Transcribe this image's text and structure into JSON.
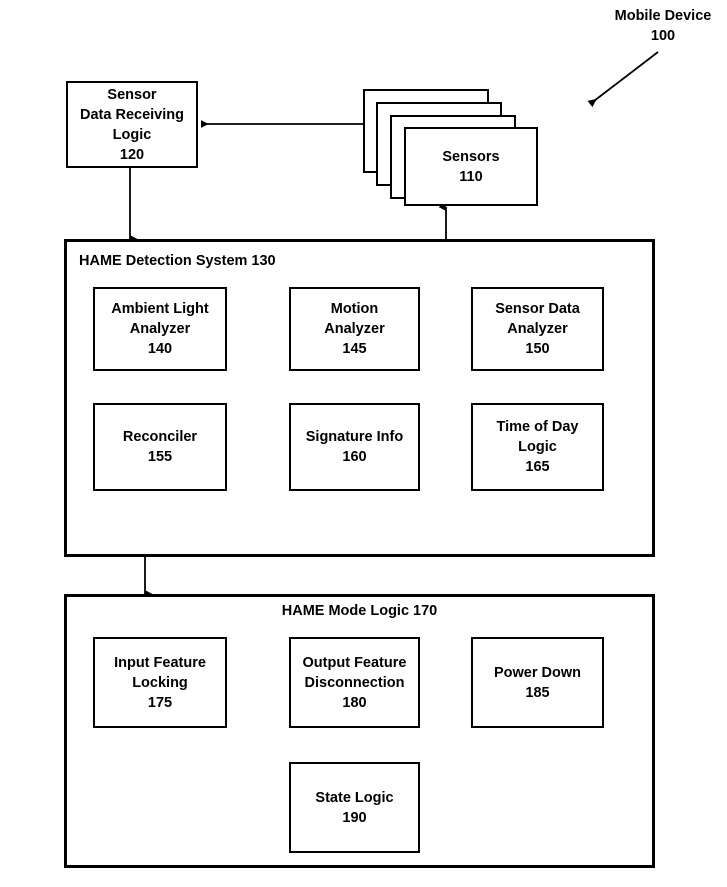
{
  "figure": {
    "type": "patent-block-diagram",
    "background_color": "#ffffff",
    "line_color": "#000000"
  },
  "annotation": {
    "mobile_device_title": "Mobile Device",
    "mobile_device_ref": "100"
  },
  "sensor_receiving": {
    "line1": "Sensor",
    "line2": "Data Receiving",
    "line3": "Logic",
    "ref": "120"
  },
  "sensors": {
    "label": "Sensors",
    "ref": "110",
    "stack_count": 4
  },
  "detection_system": {
    "title": "HAME Detection System 130",
    "blocks": [
      {
        "name": "ambient-light-analyzer",
        "line1": "Ambient Light",
        "line2": "Analyzer",
        "ref": "140"
      },
      {
        "name": "motion-analyzer",
        "line1": "Motion",
        "line2": "Analyzer",
        "ref": "145"
      },
      {
        "name": "sensor-data-analyzer",
        "line1": "Sensor Data",
        "line2": "Analyzer",
        "ref": "150"
      },
      {
        "name": "reconciler",
        "line1": "Reconciler",
        "line2": "",
        "ref": "155"
      },
      {
        "name": "signature-info",
        "line1": "Signature Info",
        "line2": "",
        "ref": "160"
      },
      {
        "name": "time-of-day-logic",
        "line1": "Time of Day",
        "line2": "Logic",
        "ref": "165"
      }
    ]
  },
  "mode_logic": {
    "title": "HAME Mode Logic 170",
    "blocks": [
      {
        "name": "input-feature-locking",
        "line1": "Input Feature",
        "line2": "Locking",
        "ref": "175"
      },
      {
        "name": "output-feature-disconnection",
        "line1": "Output Feature",
        "line2": "Disconnection",
        "ref": "180"
      },
      {
        "name": "power-down",
        "line1": "Power Down",
        "line2": "",
        "ref": "185"
      },
      {
        "name": "state-logic",
        "line1": "State Logic",
        "line2": "",
        "ref": "190"
      }
    ]
  }
}
